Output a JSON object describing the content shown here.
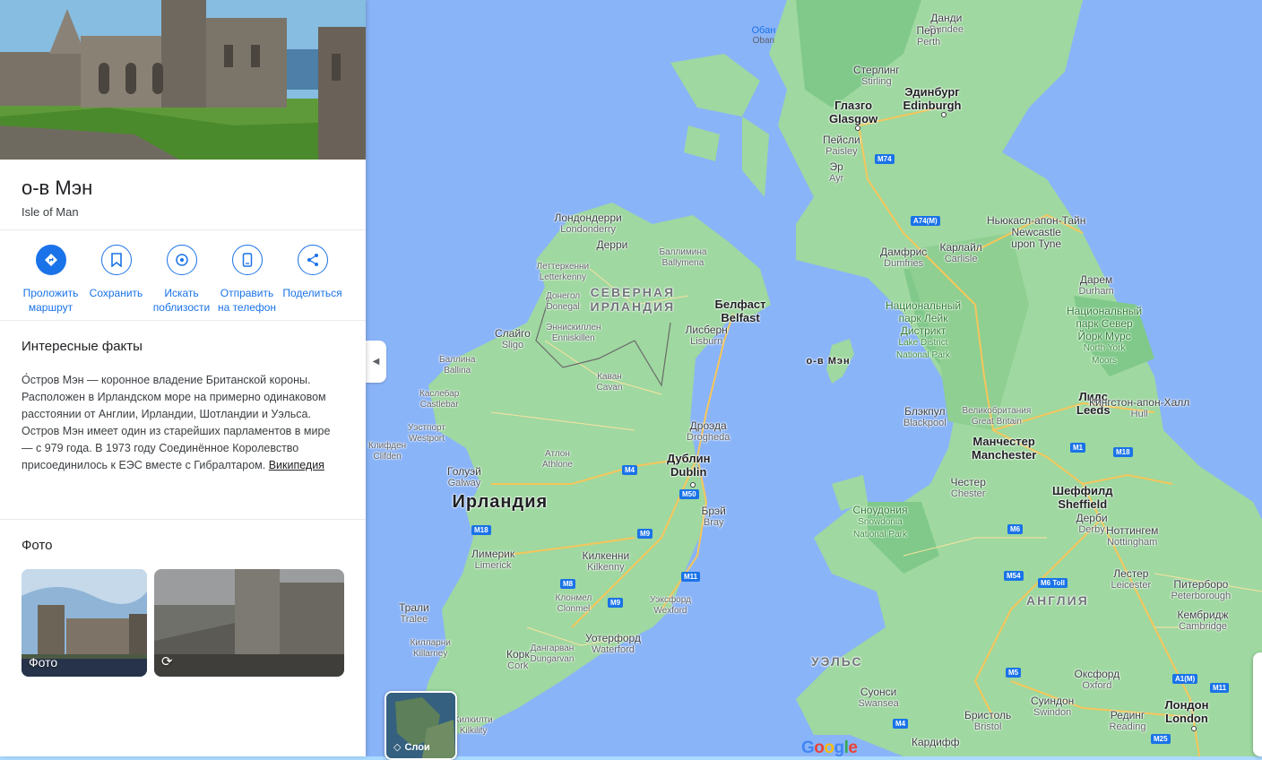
{
  "place": {
    "title": "о-в Мэн",
    "subtitle": "Isle of Man"
  },
  "actions": [
    {
      "label": "Проложить\nмаршрут",
      "icon": "directions-icon"
    },
    {
      "label": "Сохранить",
      "icon": "bookmark-icon"
    },
    {
      "label": "Искать\nпоблизости",
      "icon": "nearby-icon"
    },
    {
      "label": "Отправить\nна телефон",
      "icon": "send-to-phone-icon"
    },
    {
      "label": "Поделиться",
      "icon": "share-icon"
    }
  ],
  "facts": {
    "title": "Интересные факты",
    "text": "О́стров Мэн — коронное владение Британской короны. Расположен в Ирландском море на примерно одинаковом расстоянии от Англии, Ирландии, Шотландии и Уэльса. Остров Мэн имеет один из старейших парламентов в мире — с 979 года. В 1973 году Соединённое Королевство присоединилось к ЕЭС вместе с Гибралтаром. ",
    "link": "Википедия"
  },
  "photos": {
    "title": "Фото",
    "items": [
      {
        "caption": "Фото",
        "icon": ""
      },
      {
        "caption": "",
        "icon": "360-view-icon"
      }
    ]
  },
  "map": {
    "layers_label": "Слои",
    "logo": "Google",
    "selected_label": "о-в Мэн",
    "countries": [
      {
        "text": "Ирландия"
      }
    ],
    "regions": [
      {
        "main": "СЕВЕРНАЯ",
        "sub": "ИРЛАНДИЯ"
      },
      {
        "main": "АНГЛИЯ",
        "sub": ""
      },
      {
        "main": "УЭЛЬС",
        "sub": ""
      }
    ],
    "cities_big": [
      {
        "ru": "Глазго",
        "en": "Glasgow"
      },
      {
        "ru": "Эдинбург",
        "en": "Edinburgh"
      },
      {
        "ru": "Белфаст",
        "en": "Belfast"
      },
      {
        "ru": "Дублин",
        "en": "Dublin"
      },
      {
        "ru": "Лидс",
        "en": "Leeds"
      },
      {
        "ru": "Манчестер",
        "en": "Manchester"
      },
      {
        "ru": "Шеффилд",
        "en": "Sheffield"
      },
      {
        "ru": "Лондон",
        "en": "London"
      }
    ],
    "cities": [
      {
        "ru": "Данди",
        "en": "Dundee"
      },
      {
        "ru": "Перт",
        "en": "Perth"
      },
      {
        "ru": "Стерлинг",
        "en": "Stirling"
      },
      {
        "ru": "Пейсли",
        "en": "Paisley"
      },
      {
        "ru": "Эр",
        "en": "Ayr"
      },
      {
        "ru": "Лондондерри",
        "en": "Londonderry"
      },
      {
        "ru": "Дерри",
        "en": ""
      },
      {
        "ru": "Ньюкасл-апон-Тайн",
        "en": "Newcastle upon Tyne"
      },
      {
        "ru": "Дамфрис",
        "en": "Dumfries"
      },
      {
        "ru": "Карлайл",
        "en": "Carlisle"
      },
      {
        "ru": "Дарем",
        "en": "Durham"
      },
      {
        "ru": "Лисберн",
        "en": "Lisburn"
      },
      {
        "ru": "Слайго",
        "en": "Sligo"
      },
      {
        "ru": "Блэкпул",
        "en": "Blackpool"
      },
      {
        "ru": "Кингстон-апон-Халл",
        "en": "Hull"
      },
      {
        "ru": "Дроэда",
        "en": "Drogheda"
      },
      {
        "ru": "Голуэй",
        "en": "Galway"
      },
      {
        "ru": "Честер",
        "en": "Chester"
      },
      {
        "ru": "Дерби",
        "en": "Derby"
      },
      {
        "ru": "Ноттингем",
        "en": "Nottingham"
      },
      {
        "ru": "Лимерик",
        "en": "Limerick"
      },
      {
        "ru": "Килкенни",
        "en": "Kilkenny"
      },
      {
        "ru": "Лестер",
        "en": "Leicester"
      },
      {
        "ru": "Питерборо",
        "en": "Peterborough"
      },
      {
        "ru": "Кембридж",
        "en": "Cambridge"
      },
      {
        "ru": "Брэй",
        "en": "Bray"
      },
      {
        "ru": "Трали",
        "en": "Tralee"
      },
      {
        "ru": "Корк",
        "en": "Cork"
      },
      {
        "ru": "Уотерфорд",
        "en": "Waterford"
      },
      {
        "ru": "Суонси",
        "en": "Swansea"
      },
      {
        "ru": "Оксфорд",
        "en": "Oxford"
      },
      {
        "ru": "Суиндон",
        "en": "Swindon"
      },
      {
        "ru": "Бристоль",
        "en": "Bristol"
      },
      {
        "ru": "Рединг",
        "en": "Reading"
      },
      {
        "ru": "Кардифф",
        "en": "Cardiff"
      }
    ],
    "towns": [
      {
        "ru": "Обан",
        "en": "Oban"
      },
      {
        "ru": "Баллимина",
        "en": "Ballymena"
      },
      {
        "ru": "Леттеркенни",
        "en": "Letterkenny"
      },
      {
        "ru": "Донегол",
        "en": "Donegal"
      },
      {
        "ru": "Эннискиллен",
        "en": "Enniskillen"
      },
      {
        "ru": "Баллина",
        "en": "Ballina"
      },
      {
        "ru": "Каван",
        "en": "Cavan"
      },
      {
        "ru": "Каслебар",
        "en": "Castlebar"
      },
      {
        "ru": "Уэстпорт",
        "en": "Westport"
      },
      {
        "ru": "Клифден",
        "en": "Clifden"
      },
      {
        "ru": "Атлон",
        "en": "Athlone"
      },
      {
        "ru": "Клонмел",
        "en": "Clonmel"
      },
      {
        "ru": "Уэксфорд",
        "en": "Wexford"
      },
      {
        "ru": "Килларни",
        "en": "Killarney"
      },
      {
        "ru": "Дангарван",
        "en": "Dungarvan"
      },
      {
        "ru": "Кинсейл",
        "en": ""
      },
      {
        "ru": "Сноудония",
        "en": "Snowdonia"
      },
      {
        "ru": "Великобритания",
        "en": "Great Britain"
      },
      {
        "ru": "Килкилти",
        "en": "Kilkility"
      }
    ],
    "parks": [
      {
        "line1": "Национальный",
        "line2": "парк Лейк",
        "line3": "Дистрикт",
        "en1": "Lake District",
        "en2": "National Park"
      },
      {
        "line1": "Национальный",
        "line2": "парк Север",
        "line3": "Йорк Мурс",
        "en1": "North York",
        "en2": "Moors"
      },
      {
        "line1": "Сноудония",
        "line2": "",
        "line3": "",
        "en1": "Snowdonia",
        "en2": "National Park"
      }
    ],
    "roads": [
      "M74",
      "A74(M)",
      "M4",
      "M50",
      "M18",
      "M9",
      "M8",
      "M11",
      "M1",
      "M18",
      "M6",
      "M54",
      "M6 Toll",
      "M5",
      "M4",
      "A1(M)",
      "M11",
      "M25",
      "M6"
    ],
    "colors": {
      "water": "#8ab4f8",
      "land": "#9fd8a0",
      "land_dark": "#80c98a",
      "road": "#f9c74f",
      "road_major": "#f6b26b"
    }
  }
}
